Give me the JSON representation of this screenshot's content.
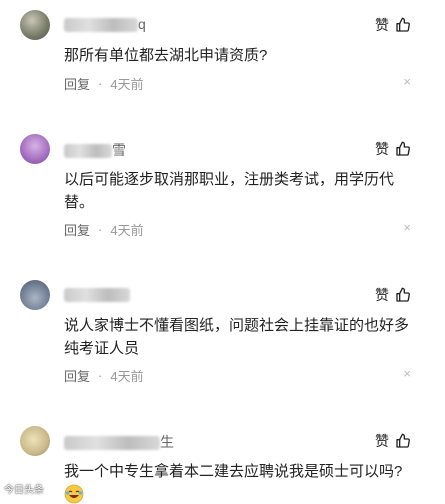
{
  "comments": [
    {
      "name": "q",
      "like_label": "赞",
      "text": "那所有单位都去湖北申请资质?",
      "reply_label": "回复",
      "dot": "·",
      "time": "4天前",
      "close": "×",
      "avatar_color": "#8a8f7a"
    },
    {
      "name": "雪",
      "like_label": "赞",
      "text": "以后可能逐步取消那职业，注册类考试，用学历代替。",
      "reply_label": "回复",
      "dot": "·",
      "time": "4天前",
      "close": "×",
      "avatar_color": "#b07cc8"
    },
    {
      "name": "",
      "like_label": "赞",
      "text": "说人家博士不懂看图纸，问题社会上挂靠证的也好多纯考证人员",
      "reply_label": "回复",
      "dot": "·",
      "time": "4天前",
      "close": "×",
      "avatar_color": "#7d8aa0"
    },
    {
      "name": "生",
      "like_label": "赞",
      "text": "我一个中专生拿着本二建去应聘说我是硕士可以吗?",
      "reply_label": "",
      "dot": "",
      "time": "",
      "close": "",
      "avatar_color": "#c9b98a"
    }
  ],
  "watermark": "今日头条"
}
